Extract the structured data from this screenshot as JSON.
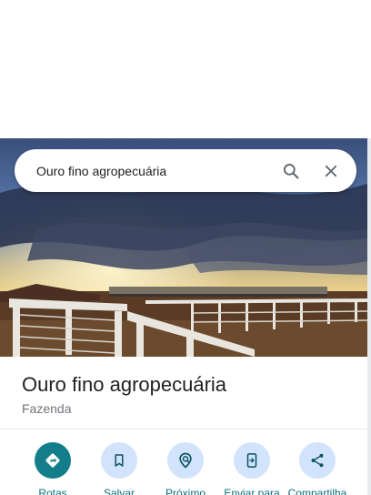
{
  "search": {
    "query": "Ouro fino agropecuária"
  },
  "place": {
    "title": "Ouro fino agropecuária",
    "category": "Fazenda"
  },
  "actions": [
    {
      "label": "Rotas",
      "icon": "directions-icon"
    },
    {
      "label": "Salvar",
      "icon": "bookmark-icon"
    },
    {
      "label": "Próximo",
      "icon": "nearby-icon"
    },
    {
      "label": "Enviar para",
      "icon": "send-to-phone-icon"
    },
    {
      "label": "Compartilha",
      "icon": "share-icon"
    }
  ],
  "colors": {
    "accent": "#137e8a",
    "action_circle": "#d2e3fc",
    "action_label": "#0a6e7d"
  }
}
